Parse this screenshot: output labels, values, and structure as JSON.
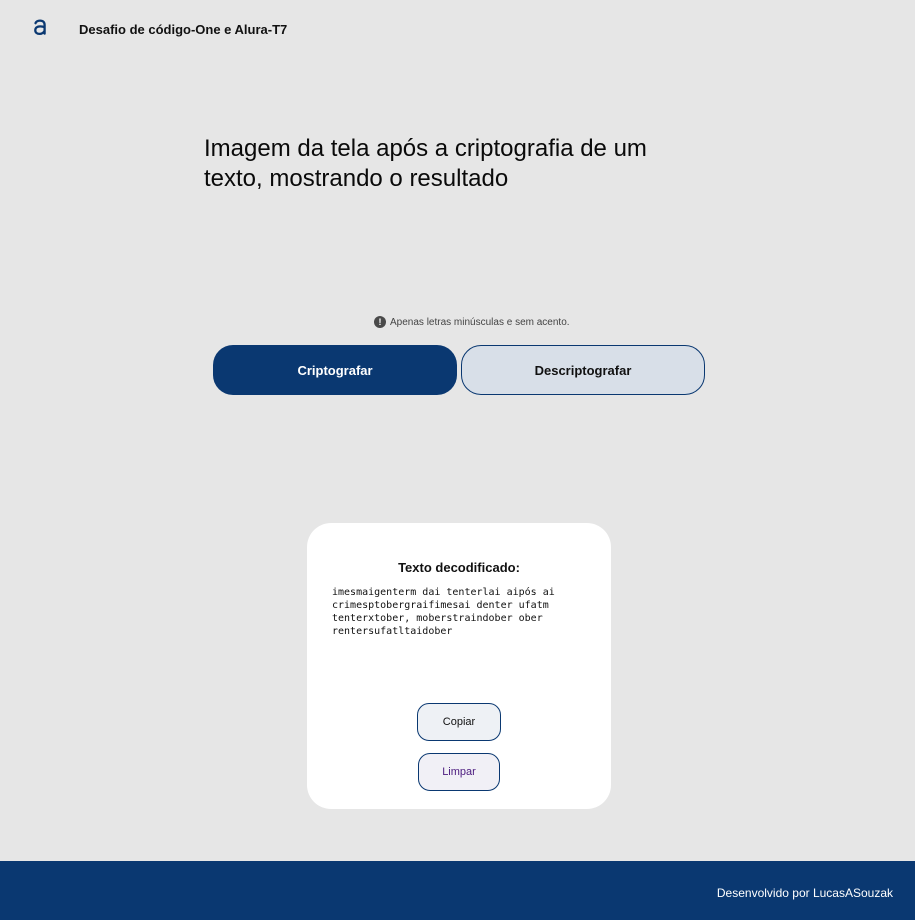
{
  "header": {
    "logo_icon": "alura-a-icon",
    "title": "Desafio de código-One e Alura-T7"
  },
  "main": {
    "input_text": "Imagem da tela após a criptografia de um texto, mostrando o resultado",
    "hint": {
      "icon": "exclamation-circle-icon",
      "text": "Apenas letras minúsculas e sem acento."
    },
    "buttons": {
      "encrypt_label": "Criptografar",
      "decrypt_label": "Descriptografar"
    }
  },
  "result_card": {
    "title": "Texto decodificado:",
    "output": "imesmaigenterm dai tenterlai aipós ai crimesptobergraifimesai denter ufatm tenterxtober, moberstraindober ober rentersufatltaidober",
    "copy_label": "Copiar",
    "clear_label": "Limpar"
  },
  "footer": {
    "credit": "Desenvolvido por LucasASouzak"
  },
  "colors": {
    "primary": "#0a3871",
    "background": "#e6e6e6",
    "card": "#ffffff",
    "secondary_button": "#d8dfe8"
  }
}
